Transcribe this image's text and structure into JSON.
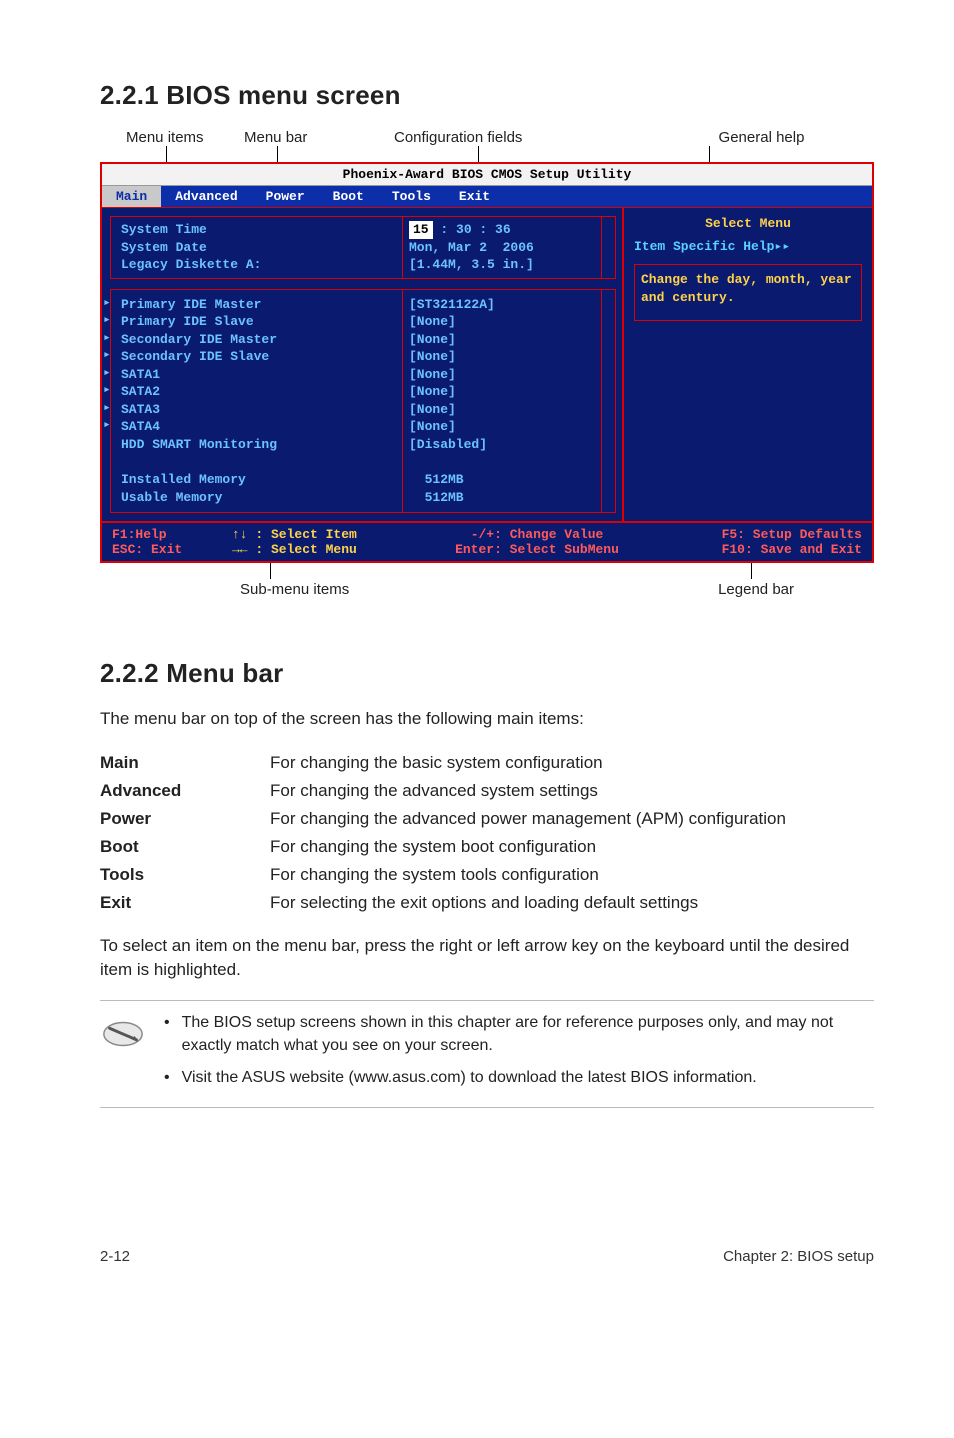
{
  "headings": {
    "s221": "2.2.1     BIOS menu screen",
    "s222": "2.2.2     Menu bar"
  },
  "labels_top": {
    "menu_items": "Menu items",
    "menu_bar": "Menu bar",
    "config_fields": "Configuration fields",
    "general_help": "General help"
  },
  "labels_bottom": {
    "sub_menu": "Sub-menu items",
    "legend_bar": "Legend bar"
  },
  "bios": {
    "title": "Phoenix-Award BIOS CMOS Setup Utility",
    "tabs": [
      "Main",
      "Advanced",
      "Power",
      "Boot",
      "Tools",
      "Exit"
    ],
    "selected_tab": "Main",
    "left_top": [
      {
        "label": "System Time",
        "value_highlight": "15",
        "value_rest": " : 30 : 36"
      },
      {
        "label": "System Date",
        "value": "Mon, Mar 2  2006"
      },
      {
        "label": "Legacy Diskette A:",
        "value": "[1.44M, 3.5 in.]"
      }
    ],
    "left_sub": [
      {
        "label": "Primary IDE Master",
        "value": "[ST321122A]"
      },
      {
        "label": "Primary IDE Slave",
        "value": "[None]"
      },
      {
        "label": "Secondary IDE Master",
        "value": "[None]"
      },
      {
        "label": "Secondary IDE Slave",
        "value": "[None]"
      },
      {
        "label": "SATA1",
        "value": "[None]"
      },
      {
        "label": "SATA2",
        "value": "[None]"
      },
      {
        "label": "SATA3",
        "value": "[None]"
      },
      {
        "label": "SATA4",
        "value": "[None]"
      },
      {
        "label": "HDD SMART Monitoring",
        "value": "[Disabled]"
      },
      {
        "label": "",
        "value": ""
      },
      {
        "label": "Installed Memory",
        "value": "  512MB"
      },
      {
        "label": "Usable Memory",
        "value": "  512MB"
      }
    ],
    "right": {
      "title": "Select Menu",
      "help": "Item Specific Help▸▸",
      "note": "Change the day, month, year and century."
    },
    "legend": {
      "l1": "F1:Help",
      "l2": "ESC: Exit",
      "m1a": "↑↓ : Select Item",
      "m1b": "→← : Select Menu",
      "c1": "-/+: Change Value",
      "c2": "Enter: Select SubMenu",
      "r1": "F5: Setup Defaults",
      "r2": "F10: Save and Exit"
    }
  },
  "menubar_intro": "The menu bar on top of the screen has the following main items:",
  "defs": [
    {
      "term": "Main",
      "desc": "For changing the basic system configuration"
    },
    {
      "term": "Advanced",
      "desc": "For changing the advanced system settings"
    },
    {
      "term": "Power",
      "desc": "For changing the advanced power management (APM) configuration"
    },
    {
      "term": "Boot",
      "desc": "For changing the system boot configuration"
    },
    {
      "term": "Tools",
      "desc": "For changing the system tools configuration"
    },
    {
      "term": "Exit",
      "desc": "For selecting the exit options and loading default settings"
    }
  ],
  "para_select": "To select an item on the menu bar, press the right or left arrow key on the keyboard until the desired item is highlighted.",
  "notes": [
    "The BIOS setup screens shown in this chapter are for reference purposes only, and may not exactly match what you see on your screen.",
    "Visit the ASUS website (www.asus.com) to download the latest BIOS information."
  ],
  "footer": {
    "left": "2-12",
    "right": "Chapter 2: BIOS setup"
  }
}
